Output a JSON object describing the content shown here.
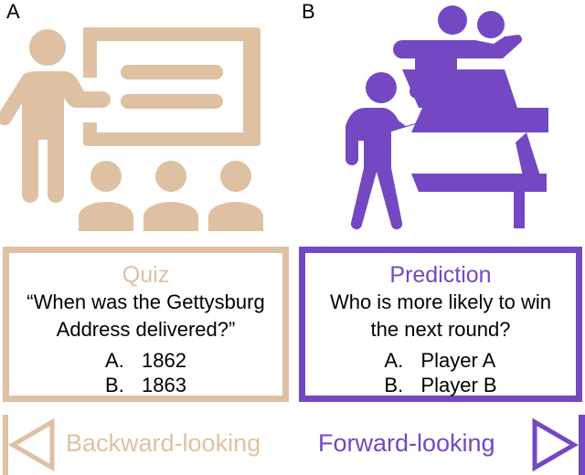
{
  "colors": {
    "backward": "#dec1a2",
    "forward": "#7448c3",
    "text": "#000000"
  },
  "panels": [
    {
      "letter": "A",
      "icon": "teacher-presentation-icon",
      "card": {
        "title": "Quiz",
        "question_lines": [
          "“When was the Gettysburg",
          "Address delivered?”"
        ],
        "options": [
          {
            "label": "A.",
            "text": "1862"
          },
          {
            "label": "B.",
            "text": "1863"
          }
        ]
      },
      "direction": {
        "label": "Backward-looking",
        "icon": "triangle-left-bar-icon"
      }
    },
    {
      "letter": "B",
      "icon": "table-tennis-players-icon",
      "card": {
        "title": "Prediction",
        "question_lines": [
          "Who is more likely to win",
          "the next round?"
        ],
        "options": [
          {
            "label": "A.",
            "text": "Player A"
          },
          {
            "label": "B.",
            "text": "Player B"
          }
        ]
      },
      "direction": {
        "label": "Forward-looking",
        "icon": "triangle-right-bar-icon"
      }
    }
  ]
}
